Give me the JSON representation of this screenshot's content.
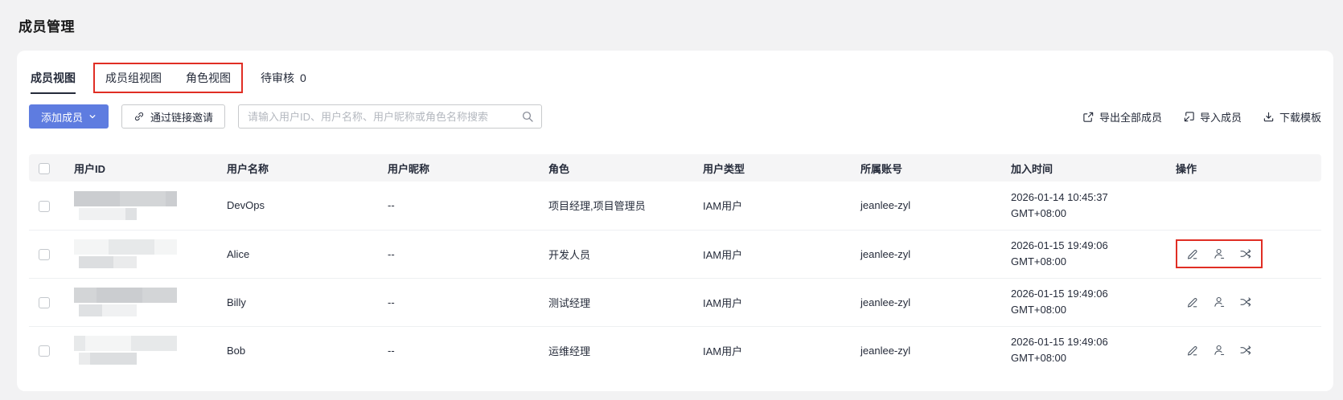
{
  "page": {
    "title": "成员管理"
  },
  "tabs": [
    {
      "label": "成员视图",
      "active": true
    },
    {
      "label": "成员组视图",
      "active": false
    },
    {
      "label": "角色视图",
      "active": false
    },
    {
      "label": "待审核",
      "count": "0",
      "active": false
    }
  ],
  "toolbar": {
    "add_member_label": "添加成员",
    "invite_link_label": "通过链接邀请",
    "search_placeholder": "请输入用户ID、用户名称、用户昵称或角色名称搜索",
    "export_all_label": "导出全部成员",
    "import_members_label": "导入成员",
    "download_template_label": "下载模板"
  },
  "table": {
    "columns": [
      "用户ID",
      "用户名称",
      "用户昵称",
      "角色",
      "用户类型",
      "所属账号",
      "加入时间",
      "操作"
    ],
    "rows": [
      {
        "user_name": "DevOps",
        "nickname": "--",
        "roles": "项目经理,项目管理员",
        "user_type": "IAM用户",
        "account": "jeanlee-zyl",
        "join_date": "2026-01-14 10:45:37",
        "join_tz": "GMT+08:00",
        "user_id_redacted": true,
        "has_actions": false,
        "actions_highlighted": false
      },
      {
        "user_name": "Alice",
        "nickname": "--",
        "roles": "开发人员",
        "user_type": "IAM用户",
        "account": "jeanlee-zyl",
        "join_date": "2026-01-15 19:49:06",
        "join_tz": "GMT+08:00",
        "user_id_redacted": true,
        "has_actions": true,
        "actions_highlighted": true
      },
      {
        "user_name": "Billy",
        "nickname": "--",
        "roles": "测试经理",
        "user_type": "IAM用户",
        "account": "jeanlee-zyl",
        "join_date": "2026-01-15 19:49:06",
        "join_tz": "GMT+08:00",
        "user_id_redacted": true,
        "has_actions": true,
        "actions_highlighted": false
      },
      {
        "user_name": "Bob",
        "nickname": "--",
        "roles": "运维经理",
        "user_type": "IAM用户",
        "account": "jeanlee-zyl",
        "join_date": "2026-01-15 19:49:06",
        "join_tz": "GMT+08:00",
        "user_id_redacted": true,
        "has_actions": true,
        "actions_highlighted": false
      }
    ]
  },
  "colors": {
    "primary_button": "#5e7ce0",
    "annotation_red": "#e02e24",
    "text": "#252b3a",
    "header_bg": "#f5f5f6"
  }
}
